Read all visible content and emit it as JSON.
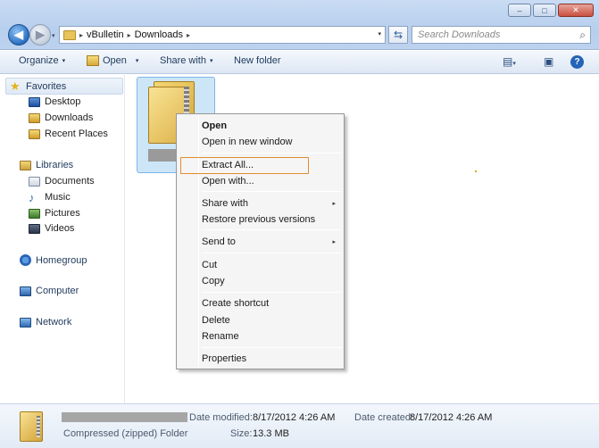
{
  "window": {
    "min_glyph": "–",
    "max_glyph": "□",
    "close_glyph": "✕"
  },
  "address": {
    "crumbs": [
      "vBulletin",
      "Downloads"
    ],
    "separator": "▸",
    "dropdown_glyph": "▾"
  },
  "search": {
    "placeholder": "Search Downloads"
  },
  "toolbar": {
    "organize": "Organize",
    "open": "Open",
    "share_with": "Share with",
    "new_folder": "New folder",
    "arrow": "▾",
    "help": "?"
  },
  "nav": {
    "favorites": "Favorites",
    "favorites_items": [
      "Desktop",
      "Downloads",
      "Recent Places"
    ],
    "libraries": "Libraries",
    "libraries_items": [
      "Documents",
      "Music",
      "Pictures",
      "Videos"
    ],
    "homegroup": "Homegroup",
    "computer": "Computer",
    "network": "Network",
    "music_glyph": "♪",
    "star_glyph": "★"
  },
  "context_menu": {
    "items": [
      "Open",
      "Open in new window",
      "Extract All...",
      "Open with...",
      "Share with",
      "Restore previous versions",
      "Send to",
      "Cut",
      "Copy",
      "Create shortcut",
      "Delete",
      "Rename",
      "Properties"
    ],
    "submenu_glyph": "▸"
  },
  "details": {
    "file_type": "Compressed (zipped) Folder",
    "date_modified_label": "Date modified:",
    "date_modified": "8/17/2012 4:26 AM",
    "date_created_label": "Date created:",
    "date_created": "8/17/2012 4:26 AM",
    "size_label": "Size:",
    "size": "13.3 MB"
  },
  "colors": {
    "selection_outline": "#e38b2f",
    "titlebar": "#c9dcf3",
    "accent": "#2364b8"
  }
}
